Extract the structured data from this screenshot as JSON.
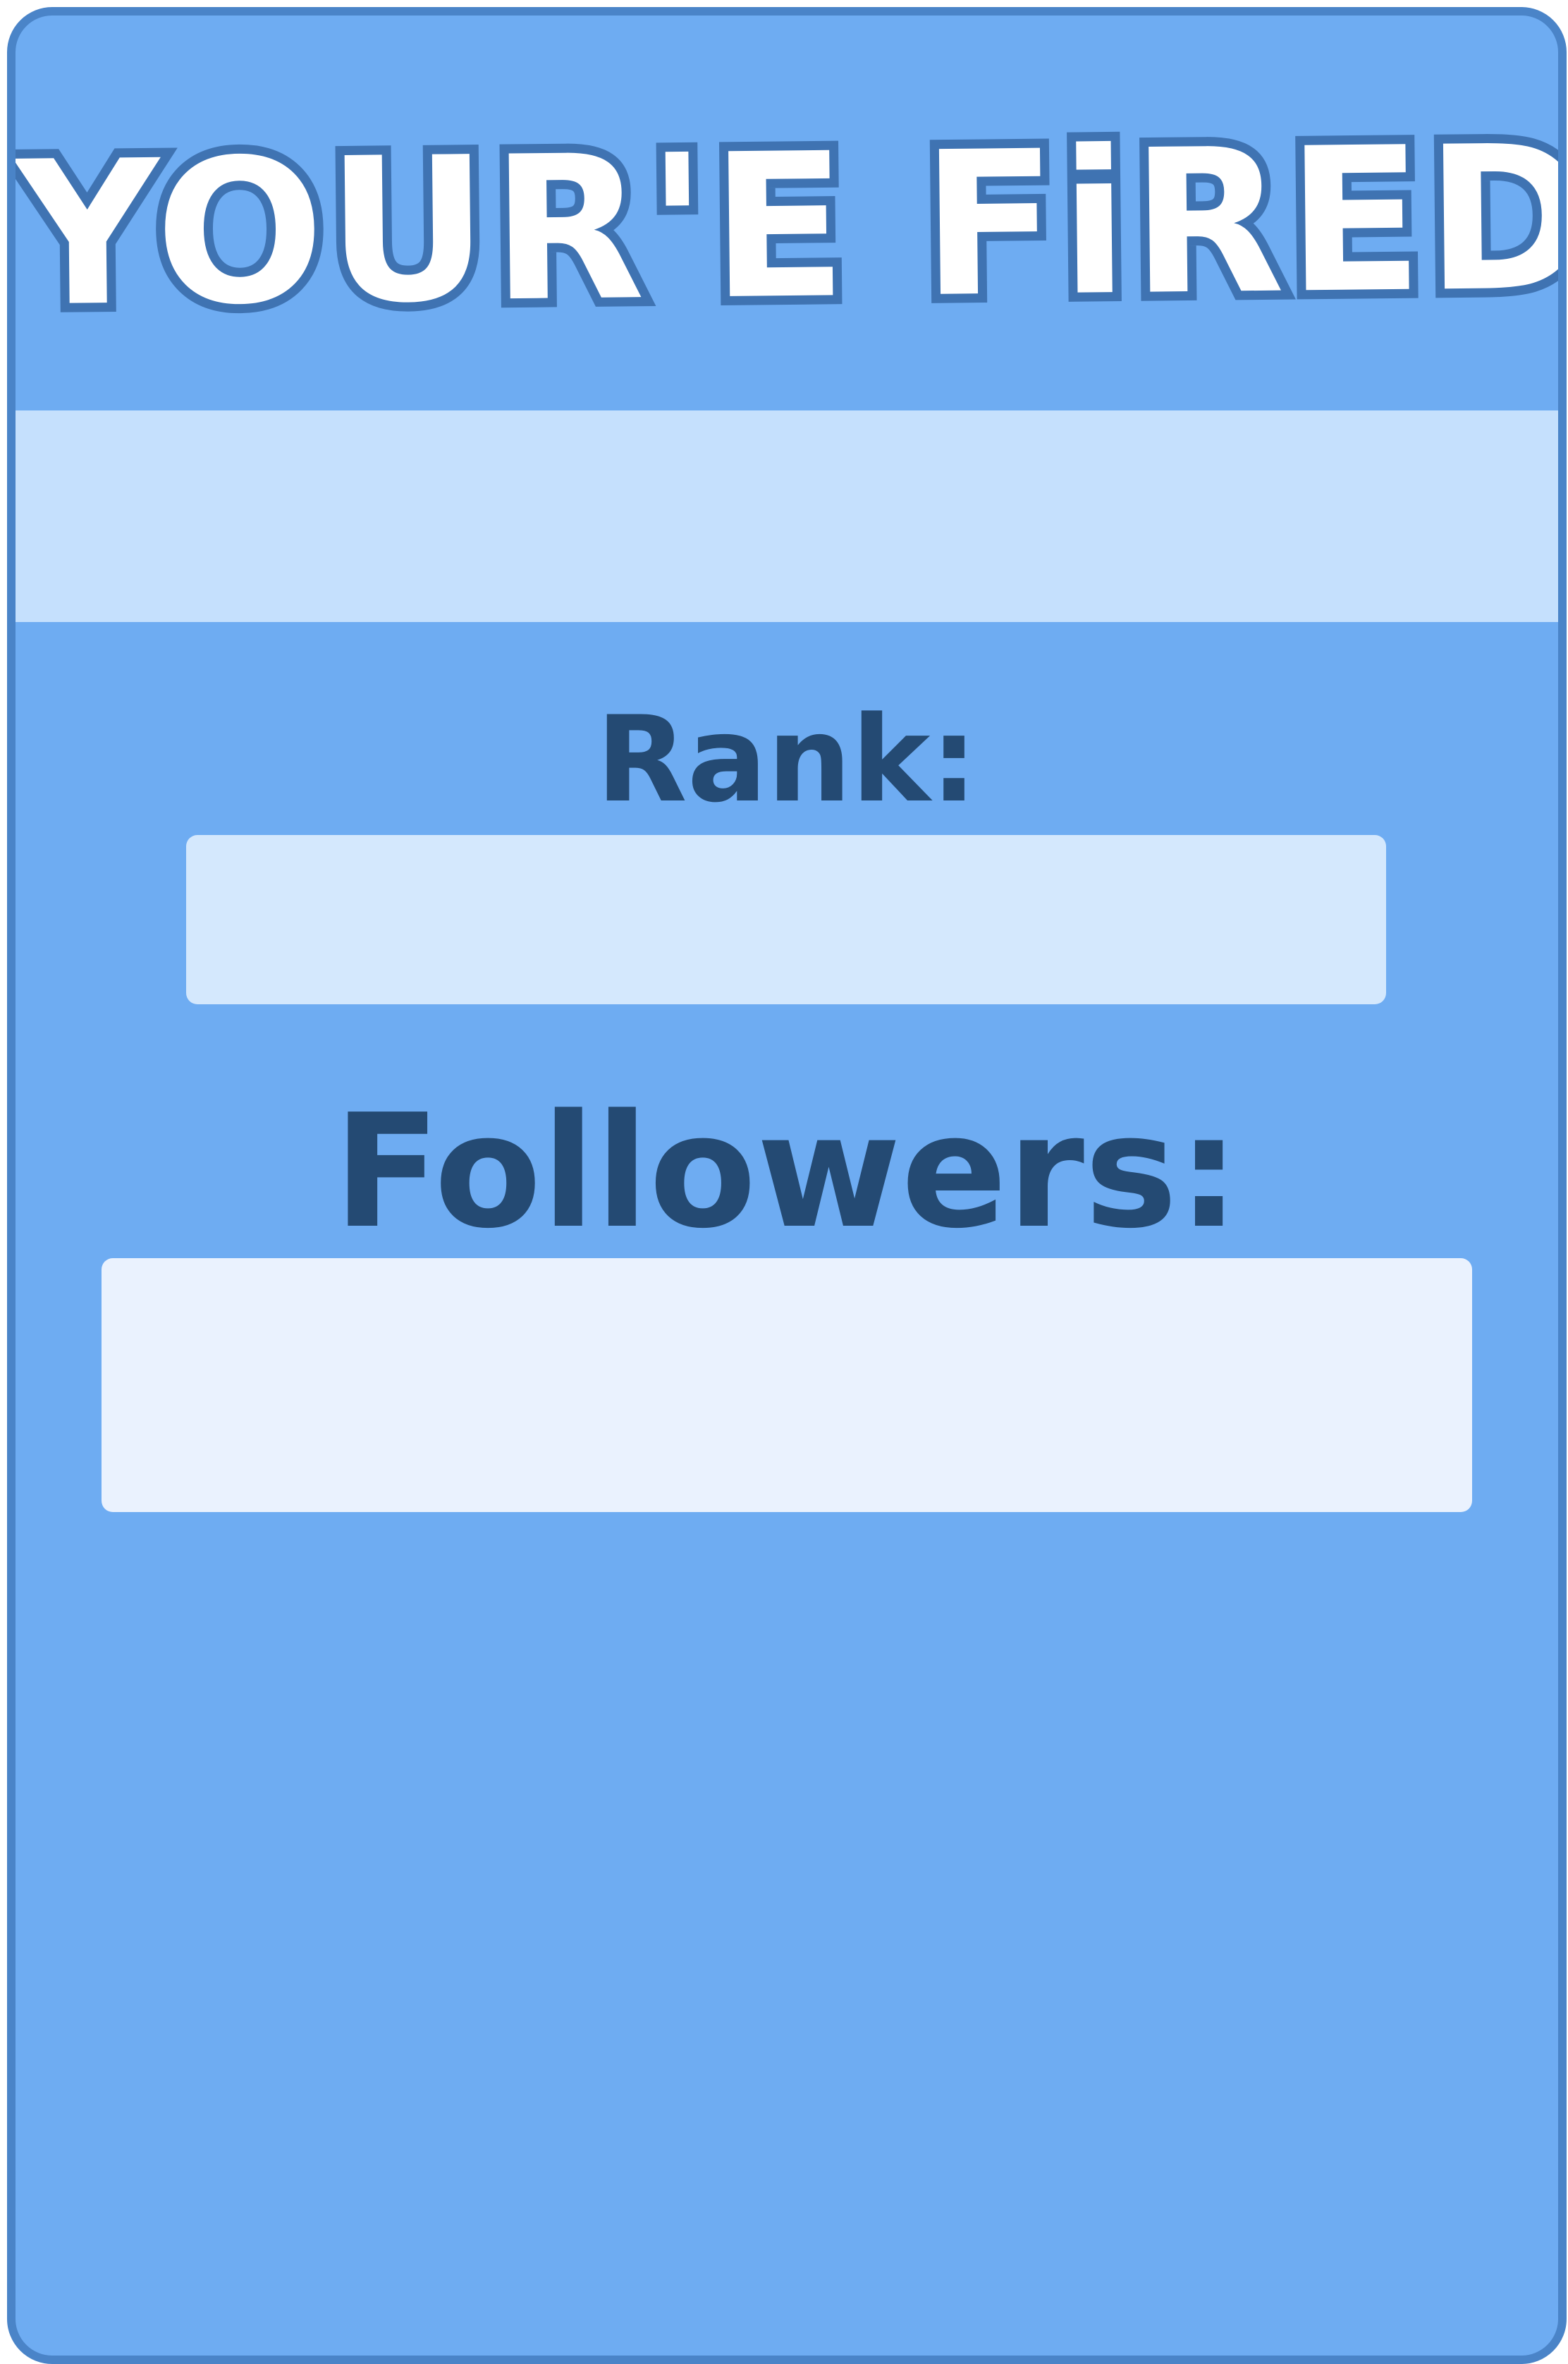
{
  "card": {
    "title": "YOUR'E FiRED",
    "rank_label": "Rank:",
    "rank_value": "",
    "followers_label": "Followers:",
    "followers_value": ""
  },
  "colors": {
    "card_background": "#6eacf2",
    "card_border": "#4a84c8",
    "title_fill": "#ffffff",
    "title_outline": "#3f73b2",
    "band": "#c5e0fd",
    "rank_field": "#d4e8fd",
    "followers_field": "#eaf2fe",
    "label_text": "#244a73"
  }
}
